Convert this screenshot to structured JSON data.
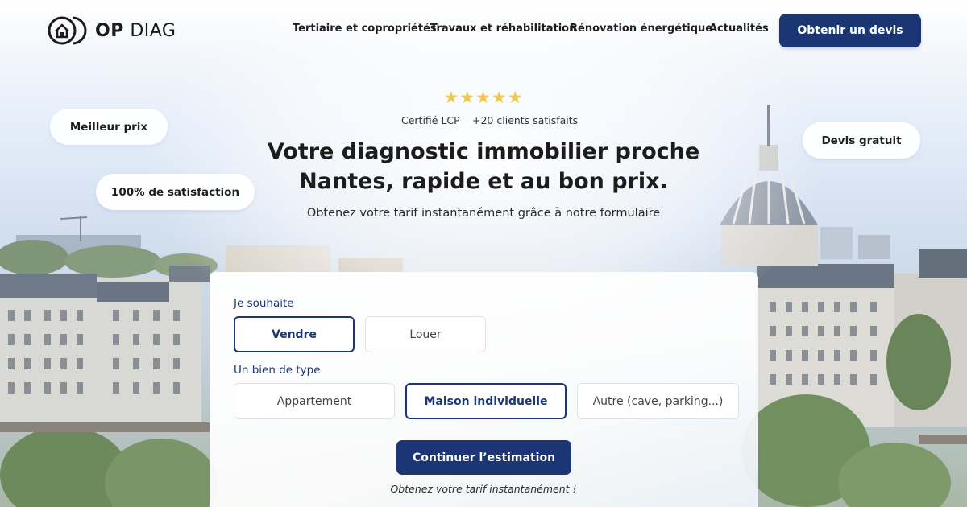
{
  "brand": {
    "name_bold": "OP",
    "name_light": "DIAG"
  },
  "nav": [
    {
      "label": "Tertiaire et copropriétés"
    },
    {
      "label": "Travaux et réhabilitation"
    },
    {
      "label": "Rénovation énergétique"
    },
    {
      "label": "Actualités"
    }
  ],
  "header": {
    "cta_label": "Obtenir un devis"
  },
  "badges": {
    "best_price": "Meilleur prix",
    "satisfaction": "100% de satisfaction",
    "free_quote": "Devis gratuit"
  },
  "hero": {
    "stars": "★★★★★",
    "rating": 5,
    "certified": "Certifié LCP",
    "clients": "+20 clients satisfaits",
    "title_line1": "Votre diagnostic immobilier proche",
    "title_line2": "Nantes, rapide et au bon prix.",
    "subtitle": "Obtenez votre tarif instantanément grâce à notre formulaire"
  },
  "form": {
    "intent_label": "Je souhaite",
    "intent_options": [
      "Vendre",
      "Louer"
    ],
    "intent_selected": "Vendre",
    "type_label": "Un bien de type",
    "type_options": [
      "Appartement",
      "Maison individuelle",
      "Autre (cave, parking...)"
    ],
    "type_selected": "Maison individuelle",
    "continue_label": "Continuer l’estimation",
    "note": "Obtenez votre tarif instantanément !"
  },
  "colors": {
    "primary": "#1b3575",
    "star": "#f3c74b",
    "text": "#1c1c1c"
  }
}
